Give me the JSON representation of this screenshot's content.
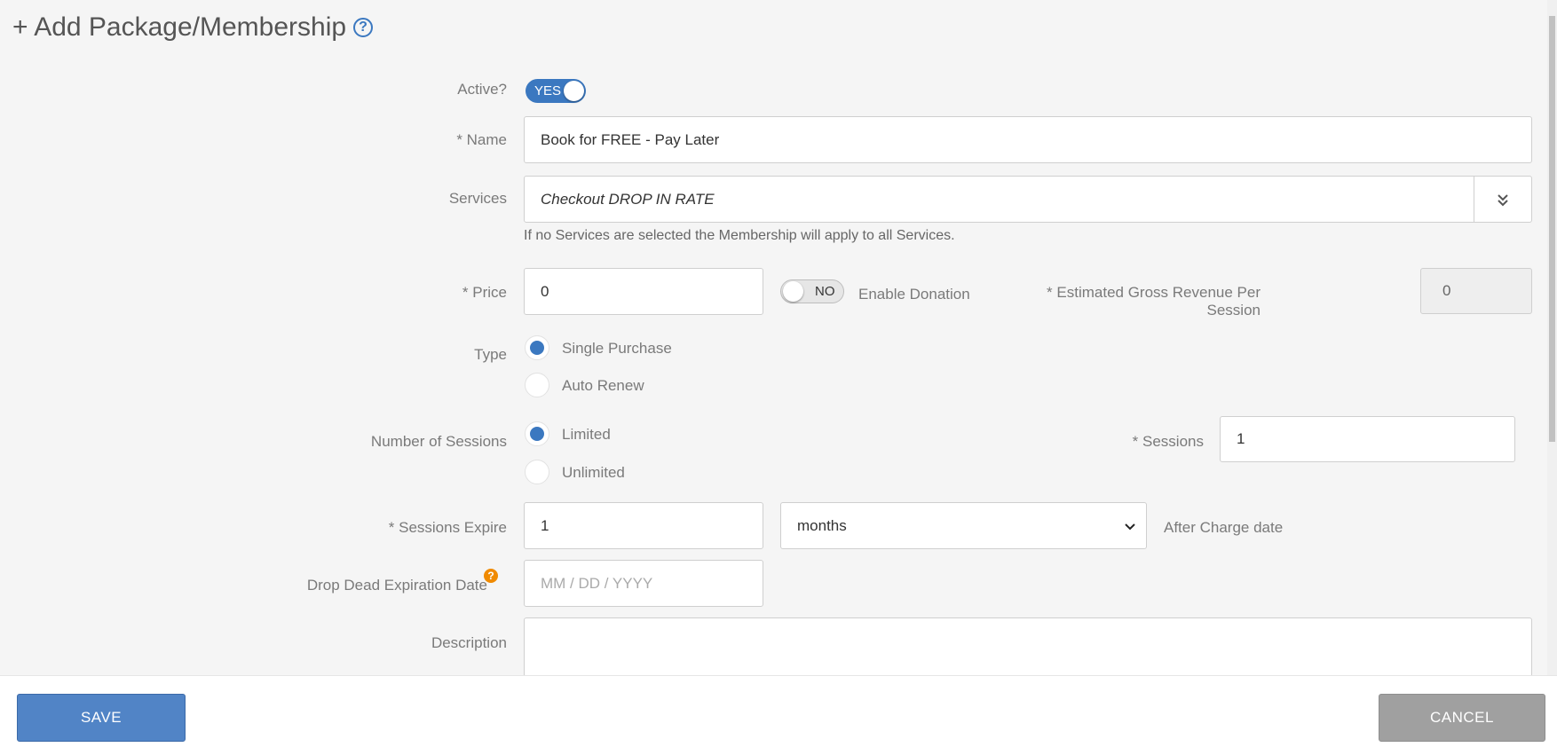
{
  "header": {
    "title": "+ Add Package/Membership",
    "help_icon": "?"
  },
  "active": {
    "label": "Active?",
    "state": "YES"
  },
  "name": {
    "label": "* Name",
    "value": "Book for FREE - Pay Later"
  },
  "services": {
    "label": "Services",
    "selected": "Checkout DROP IN RATE",
    "hint": "If no Services are selected the Membership will apply to all Services.",
    "dropdown_icon": "chevron-double-down-icon"
  },
  "price": {
    "label": "* Price",
    "value": "0"
  },
  "donation": {
    "state": "NO",
    "label": "Enable Donation"
  },
  "revenue": {
    "label_line1": "* Estimated Gross Revenue Per",
    "label_line2": "Session",
    "value": "0"
  },
  "type": {
    "label": "Type",
    "options": [
      {
        "label": "Single Purchase",
        "checked": true
      },
      {
        "label": "Auto Renew",
        "checked": false
      }
    ]
  },
  "num_sessions": {
    "label": "Number of Sessions",
    "options": [
      {
        "label": "Limited",
        "checked": true
      },
      {
        "label": "Unlimited",
        "checked": false
      }
    ]
  },
  "sessions": {
    "label": "* Sessions",
    "value": "1"
  },
  "sessions_expire": {
    "label": "* Sessions Expire",
    "value": "1",
    "unit": "months",
    "suffix": "After Charge date"
  },
  "drop_dead": {
    "label": "Drop Dead Expiration Date",
    "placeholder": "MM / DD / YYYY",
    "help": "?"
  },
  "description": {
    "label": "Description",
    "value": ""
  },
  "footer": {
    "save_label": "SAVE",
    "cancel_label": "CANCEL"
  },
  "colors": {
    "accent": "#3b78c0",
    "save": "#5184c6",
    "cancel": "#a0a0a0",
    "help": "#f08a00"
  }
}
